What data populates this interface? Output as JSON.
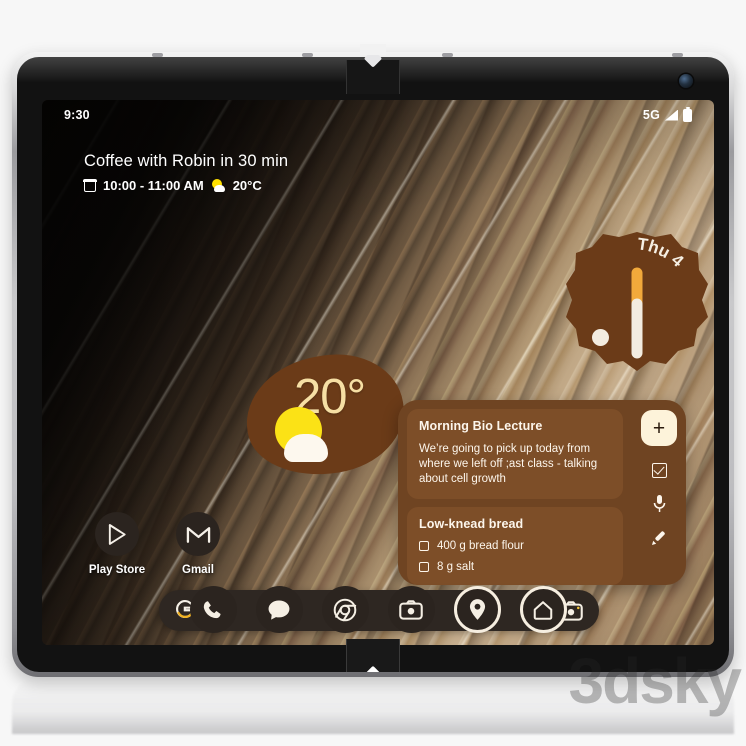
{
  "device": {
    "name": "foldable-phone",
    "front_camera": "front-camera-lens"
  },
  "status_bar": {
    "time": "9:30",
    "network": "5G",
    "signal_icon": "signal-bars-icon",
    "battery_icon": "battery-icon"
  },
  "at_a_glance": {
    "title": "Coffee with Robin in 30 min",
    "calendar_icon": "calendar-icon",
    "time_range": "10:00 - 11:00 AM",
    "weather_icon": "sun-cloud-icon",
    "temperature": "20°C"
  },
  "clock_widget": {
    "date_label": "Thu 4",
    "hour_hand_color": "#f2a93b",
    "minute_hand_color": "#f3ece0",
    "background_color": "#6b3b18"
  },
  "weather_widget": {
    "temperature": "20°",
    "icon": "sun-cloud-icon",
    "background_color": "#6b3b18",
    "text_color": "#f6dfa4"
  },
  "keep_widget": {
    "background_color": "#6f4422",
    "notes": [
      {
        "title": "Morning Bio Lecture",
        "body": "We’re going to pick up today from where we left off ;ast class - talking about cell growth",
        "items": []
      },
      {
        "title": "Low-knead bread",
        "body": "",
        "items": [
          "400 g bread flour",
          "8 g salt"
        ]
      }
    ],
    "actions": [
      {
        "name": "add-note-button",
        "icon": "plus-icon",
        "label": "+"
      },
      {
        "name": "new-list-button",
        "icon": "checkbox-icon",
        "label": ""
      },
      {
        "name": "voice-note-button",
        "icon": "microphone-icon",
        "label": ""
      },
      {
        "name": "drawing-note-button",
        "icon": "pen-icon",
        "label": ""
      }
    ]
  },
  "apps": [
    {
      "label": "Play Store",
      "icon": "play-store-icon"
    },
    {
      "label": "Gmail",
      "icon": "gmail-icon"
    }
  ],
  "search": {
    "logo": "google-g-icon",
    "placeholder": "",
    "value": "",
    "mic_icon": "microphone-icon",
    "lens_icon": "google-lens-camera-icon"
  },
  "dock": [
    {
      "label": "Phone",
      "icon": "phone-icon",
      "ringed": false
    },
    {
      "label": "Messages",
      "icon": "message-bubble-icon",
      "ringed": false
    },
    {
      "label": "Chrome",
      "icon": "chrome-icon",
      "ringed": false
    },
    {
      "label": "Camera",
      "icon": "camera-icon",
      "ringed": false
    },
    {
      "label": "Maps",
      "icon": "map-pin-icon",
      "ringed": true
    },
    {
      "label": "Home",
      "icon": "home-icon",
      "ringed": true
    }
  ],
  "watermark": {
    "text": "3dsky"
  }
}
